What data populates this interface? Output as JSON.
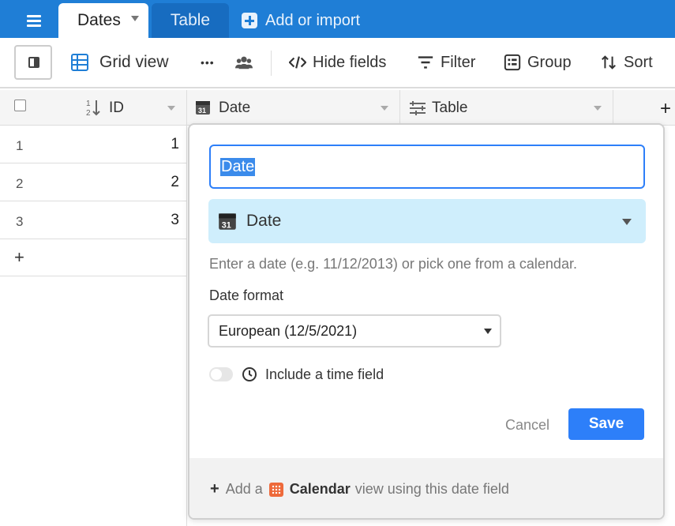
{
  "tabs": {
    "active": "Dates",
    "second": "Table",
    "add_import": "Add or import"
  },
  "toolbar": {
    "view_name": "Grid view",
    "more": "•••",
    "hide_fields": "Hide fields",
    "filter": "Filter",
    "group": "Group",
    "sort": "Sort"
  },
  "grid": {
    "columns": [
      "ID",
      "Date",
      "Table"
    ],
    "rows": [
      {
        "num": "1",
        "id": "1"
      },
      {
        "num": "2",
        "id": "2"
      },
      {
        "num": "3",
        "id": "3"
      }
    ],
    "add_row": "+",
    "add_column": "+"
  },
  "popup": {
    "field_name": "Date",
    "field_type": "Date",
    "help_text": "Enter a date (e.g. 11/12/2013) or pick one from a calendar.",
    "format_label": "Date format",
    "format_value": "European (12/5/2021)",
    "time_label": "Include a time field",
    "cancel": "Cancel",
    "save": "Save",
    "footer": {
      "plus": "+",
      "prefix": "Add a",
      "view": "Calendar",
      "suffix": "view using this date field"
    }
  },
  "colors": {
    "brand_blue": "#1f7ed6",
    "primary": "#2d7ff9",
    "type_bg": "#cfeefc",
    "calendar_orange": "#ee6a3b"
  }
}
